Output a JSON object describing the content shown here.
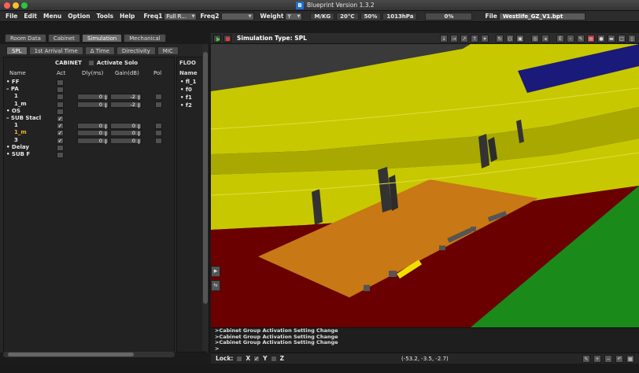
{
  "window": {
    "title": "Blueprint Version 1.3.2",
    "icon_letter": "B"
  },
  "menubar": {
    "items": [
      "File",
      "Edit",
      "Menu",
      "Option",
      "Tools",
      "Help"
    ],
    "freq1_label": "Freq1",
    "freq1_value": "Full R...",
    "freq2_label": "Freq2",
    "freq2_value": "",
    "weight_label": "Weight",
    "weight_value": "Y",
    "unit": "M/KG",
    "temperature": "20°C",
    "humidity": "50%",
    "pressure": "1013hPa",
    "progress": "0%",
    "file_label": "File",
    "file_value": "Westlife_GZ_V1.bpt"
  },
  "main_tabs": [
    "Room Data",
    "Cabinet",
    "Simulation",
    "Mechanical"
  ],
  "main_tab_active": "Simulation",
  "sub_tabs": [
    "SPL",
    "1st Arrival Time",
    "Δ Time",
    "Directivity",
    "MIC"
  ],
  "sub_tab_active": "SPL",
  "cabinet_panel": {
    "section_label": "CABINET",
    "activate_solo_label": "Activate Solo",
    "columns": [
      "Name",
      "Act",
      "Dly(ms)",
      "Gain(dB)",
      "Pol"
    ],
    "rows": [
      {
        "name": "• FF",
        "act": false
      },
      {
        "name": "– PA",
        "act": false
      },
      {
        "name": "1",
        "act": false,
        "delay": "0",
        "gain": "-2",
        "pol": true
      },
      {
        "name": "1_m",
        "act": false,
        "delay": "0",
        "gain": "-2",
        "pol": true
      },
      {
        "name": "• OS",
        "act": false
      },
      {
        "name": "– SUB Stacl",
        "act": true
      },
      {
        "name": "1",
        "act": true,
        "delay": "0",
        "gain": "0",
        "pol": true
      },
      {
        "name": "1_m",
        "act": true,
        "delay": "0",
        "gain": "0",
        "pol": true,
        "highlight": true
      },
      {
        "name": "3",
        "act": true,
        "delay": "0",
        "gain": "0",
        "pol": true
      },
      {
        "name": "• Delay",
        "act": false
      },
      {
        "name": "• SUB F",
        "act": false
      }
    ]
  },
  "floor_panel": {
    "header": "FLOO",
    "column": "Name",
    "rows": [
      "• fl_1",
      "• f0",
      "• f1",
      "• f2"
    ]
  },
  "sim_toolbar": {
    "sim_type": "Simulation Type: SPL"
  },
  "console": {
    "lines": [
      ">Cabinet Group Activation Setting Change",
      ">Cabinet Group Activation Setting Change",
      ">Cabinet Group Activation Setting Change",
      ">"
    ]
  },
  "statusbar": {
    "lock_label": "Lock:",
    "axes": [
      {
        "label": "X",
        "checked": false
      },
      {
        "label": "Y",
        "checked": true
      },
      {
        "label": "Z",
        "checked": false
      }
    ],
    "coords": "(-53.2, -3.5, -2.7)"
  },
  "scene_colors": {
    "stands": "#c8c800",
    "floor": "#6a0000",
    "stage": "#c87814",
    "grass": "#1a8a1a",
    "screen": "#1a1a7a"
  },
  "icons": {
    "toolbar": [
      "arrow-down-icon",
      "arrow-right-icon",
      "arrow-upright-icon",
      "arrow-up-icon",
      "menu-icon",
      "rotate-icon",
      "bracket-icon",
      "view-icon",
      "reset-icon",
      "share-icon",
      "e-icon",
      "chevron-left-icon",
      "pen-icon",
      "layer-icon",
      "group-icon",
      "image-icon",
      "frame-icon",
      "device-icon"
    ],
    "status": [
      "pencil-icon",
      "plus-icon",
      "minus-icon",
      "undo-icon",
      "grid-icon"
    ]
  }
}
